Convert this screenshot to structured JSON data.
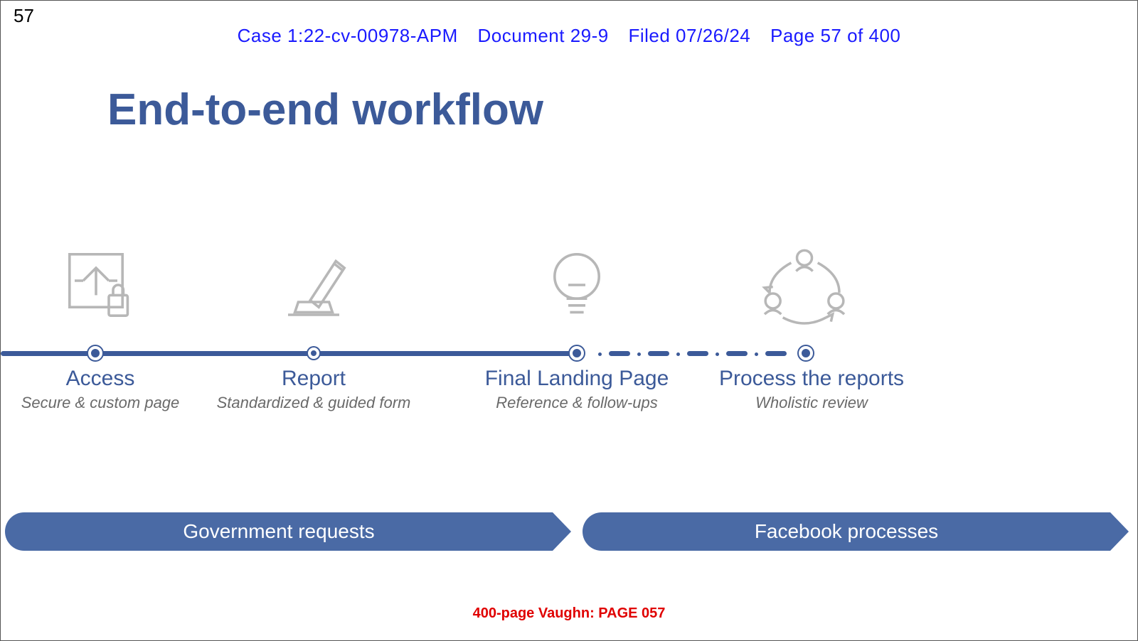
{
  "page_number_top": "57",
  "court_header": {
    "case": "Case 1:22-cv-00978-APM",
    "document": "Document 29-9",
    "filed": "Filed 07/26/24",
    "page": "Page 57 of 400"
  },
  "title": "End-to-end workflow",
  "steps": [
    {
      "title": "Access",
      "sub": "Secure & custom page"
    },
    {
      "title": "Report",
      "sub": "Standardized & guided form"
    },
    {
      "title": "Final Landing Page",
      "sub": "Reference & follow-ups"
    },
    {
      "title": "Process the reports",
      "sub": "Wholistic review"
    }
  ],
  "arrows": {
    "left": "Government requests",
    "right": "Facebook processes"
  },
  "footer": "400-page Vaughn: PAGE 057"
}
